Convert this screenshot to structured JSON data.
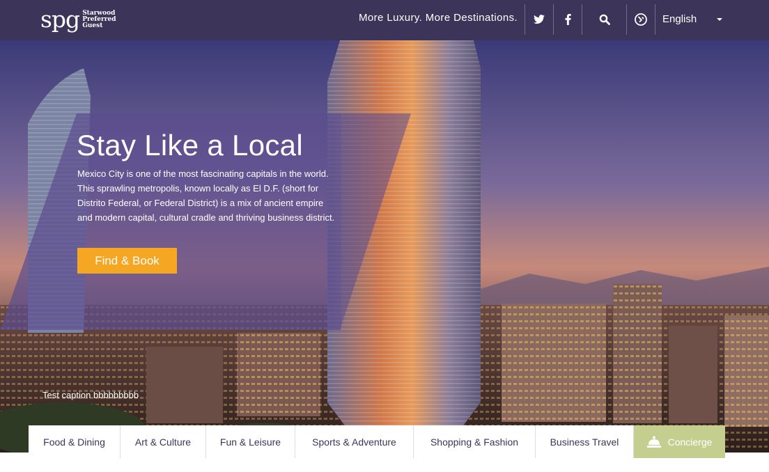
{
  "header": {
    "logo": {
      "mark": "spg",
      "line1": "Starwood",
      "line2": "Preferred",
      "line3": "Guest"
    },
    "tagline": "More Luxury. More Destinations.",
    "icons": [
      "twitter-icon",
      "facebook-icon",
      "search-icon",
      "concierge-badge-icon"
    ],
    "language": "English"
  },
  "hero": {
    "title": "Stay Like a Local",
    "body": "Mexico City is one of the most fascinating capitals in the world. This sprawling metropolis, known locally as El D.F. (short for Distrito Federal, or Federal District) is a mix of ancient empire and modern capital, cultural cradle and thriving business district.",
    "cta": "Find & Book",
    "caption": "Test caption bbbbbbbbb"
  },
  "tabs": [
    {
      "label": "Food & Dining"
    },
    {
      "label": "Art & Culture"
    },
    {
      "label": "Fun & Leisure"
    },
    {
      "label": "Sports & Adventure"
    },
    {
      "label": "Shopping & Fashion"
    },
    {
      "label": "Business Travel"
    },
    {
      "label": "Concierge"
    }
  ],
  "colors": {
    "header_bg": "#3c3459",
    "cta": "#f5a623",
    "concierge_tab": "#c4cf8f",
    "tab_text": "#3c3459"
  }
}
